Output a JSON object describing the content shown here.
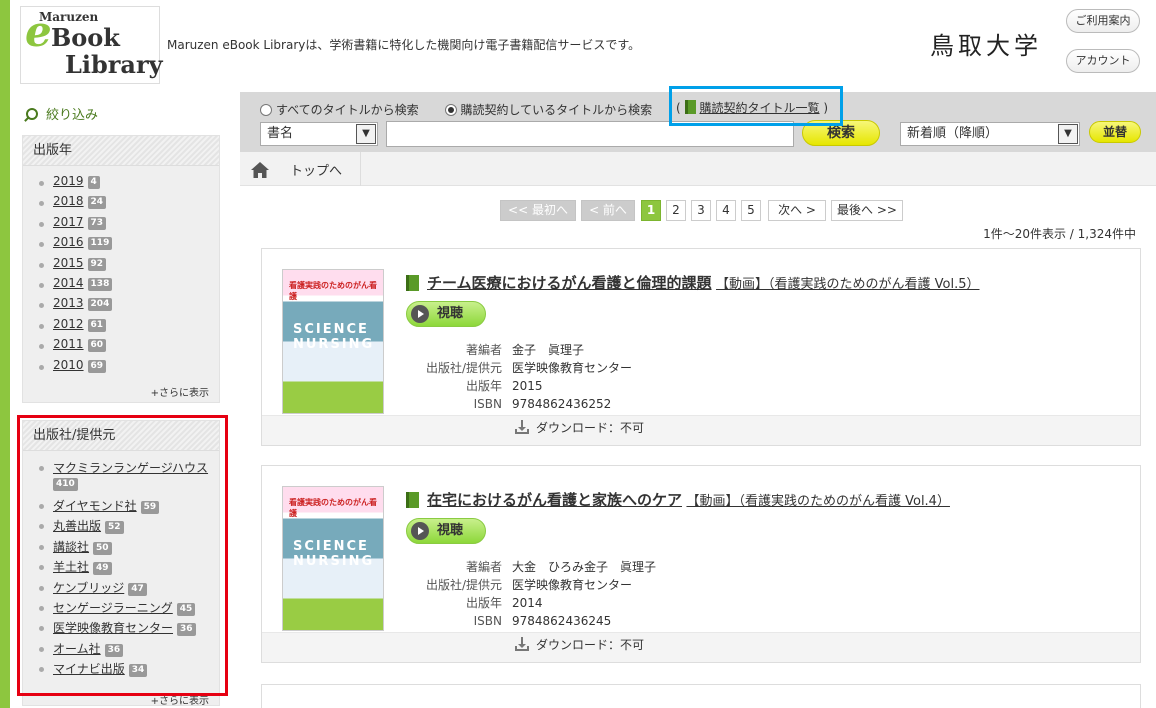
{
  "header": {
    "logo_maruzen": "Maruzen",
    "logo_book": "Book",
    "logo_library": "Library",
    "logo_e": "e",
    "tagline": "Maruzen eBook Libraryは、学術書籍に特化した機関向け電子書籍配信サービスです。",
    "institution": "鳥取大学",
    "guide_button": "ご利用案内",
    "account_button": "アカウント"
  },
  "sidebar": {
    "filter_title": "絞り込み",
    "year_panel": {
      "title": "出版年",
      "items": [
        {
          "label": "2019",
          "count": "4"
        },
        {
          "label": "2018",
          "count": "24"
        },
        {
          "label": "2017",
          "count": "73"
        },
        {
          "label": "2016",
          "count": "119"
        },
        {
          "label": "2015",
          "count": "92"
        },
        {
          "label": "2014",
          "count": "138"
        },
        {
          "label": "2013",
          "count": "204"
        },
        {
          "label": "2012",
          "count": "61"
        },
        {
          "label": "2011",
          "count": "60"
        },
        {
          "label": "2010",
          "count": "69"
        }
      ],
      "more": "+さらに表示"
    },
    "publisher_panel": {
      "title": "出版社/提供元",
      "items": [
        {
          "label": "マクミランランゲージハウス",
          "count": "410"
        },
        {
          "label": "ダイヤモンド社",
          "count": "59"
        },
        {
          "label": "丸善出版",
          "count": "52"
        },
        {
          "label": "講談社",
          "count": "50"
        },
        {
          "label": "羊土社",
          "count": "49"
        },
        {
          "label": "ケンブリッジ",
          "count": "47"
        },
        {
          "label": "センゲージラーニング",
          "count": "45"
        },
        {
          "label": "医学映像教育センター",
          "count": "36"
        },
        {
          "label": "オーム社",
          "count": "36"
        },
        {
          "label": "マイナビ出版",
          "count": "34"
        }
      ],
      "more": "+さらに表示"
    }
  },
  "search": {
    "radio_all": "すべてのタイトルから検索",
    "radio_subscribed": "購読契約しているタイトルから検索",
    "subscribed_list_link": "購読契約タイトル一覧",
    "open_paren": "(",
    "close_paren": ")",
    "field_select": "書名",
    "query_value": "",
    "search_button": "検索",
    "sort_select": "新着順（降順）",
    "sort_button": "並替"
  },
  "breadcrumb": {
    "top": "トップへ"
  },
  "pagination": {
    "first": "<< 最初へ",
    "prev": "< 前へ",
    "pages": [
      "1",
      "2",
      "3",
      "4",
      "5"
    ],
    "current": "1",
    "next": "次へ >",
    "last": "最後へ >>",
    "count_text": "1件～20件表示 / 1,324件中"
  },
  "results": [
    {
      "title": "チーム医療におけるがん看護と倫理的課題",
      "subtitle": "【動画】（看護実践のためのがん看護 Vol.5）",
      "watch_label": "視聴",
      "meta_labels": [
        "著編者",
        "出版社/提供元",
        "出版年",
        "ISBN"
      ],
      "meta_values": [
        "金子　眞理子",
        "医学映像教育センター",
        "2015",
        "9784862436252"
      ],
      "download": "ダウンロード：不可",
      "thumb_series": "看護実践のためのがん看護",
      "thumb_word": "SCIENCE NURSING"
    },
    {
      "title": "在宅におけるがん看護と家族へのケア",
      "subtitle": "【動画】（看護実践のためのがん看護 Vol.4）",
      "watch_label": "視聴",
      "meta_labels": [
        "著編者",
        "出版社/提供元",
        "出版年",
        "ISBN"
      ],
      "meta_values": [
        "大金　ひろみ金子　眞理子",
        "医学映像教育センター",
        "2014",
        "9784862436245"
      ],
      "download": "ダウンロード：不可",
      "thumb_series": "看護実践のためのがん看護",
      "thumb_word": "SCIENCE NURSING"
    }
  ],
  "colors": {
    "brand_green": "#8dc63f",
    "highlight_red": "#e60012",
    "highlight_blue": "#00a0e9",
    "button_yellow": "#e6e600"
  }
}
